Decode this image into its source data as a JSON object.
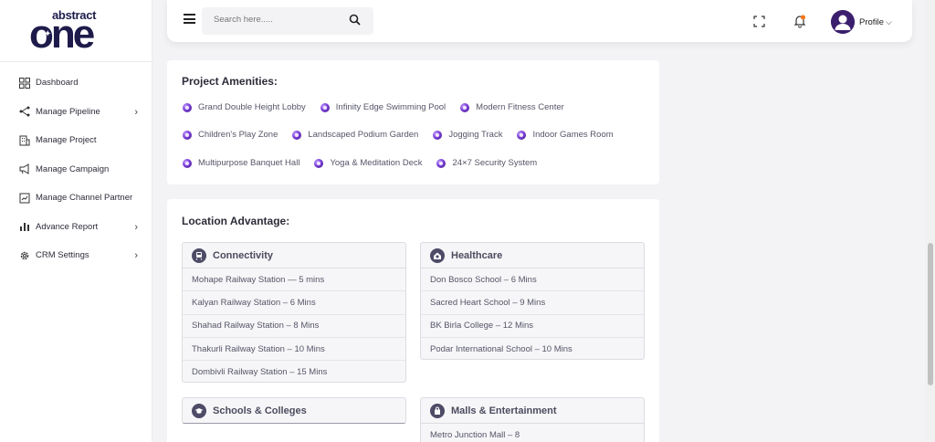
{
  "brand": {
    "top": "abstract",
    "big": "one"
  },
  "sidebar": {
    "items": [
      {
        "label": "Dashboard",
        "icon": "dashboard-icon",
        "chevron": false
      },
      {
        "label": "Manage Pipeline",
        "icon": "pipeline-icon",
        "chevron": true
      },
      {
        "label": "Manage Project",
        "icon": "building-icon",
        "chevron": false
      },
      {
        "label": "Manage Campaign",
        "icon": "megaphone-icon",
        "chevron": false
      },
      {
        "label": "Manage Channel Partner",
        "icon": "handshake-icon",
        "chevron": false
      },
      {
        "label": "Advance Report",
        "icon": "bar-chart-icon",
        "chevron": true
      },
      {
        "label": "CRM Settings",
        "icon": "gear-icon",
        "chevron": true
      }
    ]
  },
  "header": {
    "search_placeholder": "Search here.....",
    "profile_label": "Profile"
  },
  "amenities": {
    "title": "Project Amenities:",
    "rows": [
      [
        "Grand Double Height Lobby",
        "Infinity Edge Swimming Pool",
        "Modern Fitness Center"
      ],
      [
        "Children's Play Zone",
        "Landscaped Podium Garden",
        "Jogging Track",
        "Indoor Games Room"
      ],
      [
        "Multipurpose Banquet Hall",
        "Yoga & Meditation Deck",
        "24×7 Security System"
      ]
    ]
  },
  "location": {
    "title": "Location Advantage:",
    "connectivity": {
      "title": "Connectivity",
      "icon": "train-icon",
      "items": [
        "Mohape Railway Station — 5 mins",
        "Kalyan Railway Station – 6 Mins",
        "Shahad Railway Station – 8 Mins",
        "Thakurli Railway Station – 10 Mins",
        "Dombivli Railway Station – 15 Mins"
      ]
    },
    "healthcare": {
      "title": "Healthcare",
      "icon": "hospital-icon",
      "items": [
        "Don Bosco School – 6 Mins",
        "Sacred Heart School – 9 Mins",
        "BK Birla College – 12 Mins",
        "Podar International School – 10 Mins"
      ]
    },
    "schools": {
      "title": "Schools & Colleges",
      "icon": "graduation-cap-icon"
    },
    "malls": {
      "title": "Malls & Entertainment",
      "icon": "shopping-bag-icon",
      "items": [
        "Metro Junction Mall – 8"
      ]
    }
  },
  "colors": {
    "accent": "#7c3aed",
    "brand_dark": "#1e1b4b",
    "notification_dot": "#f97316"
  }
}
